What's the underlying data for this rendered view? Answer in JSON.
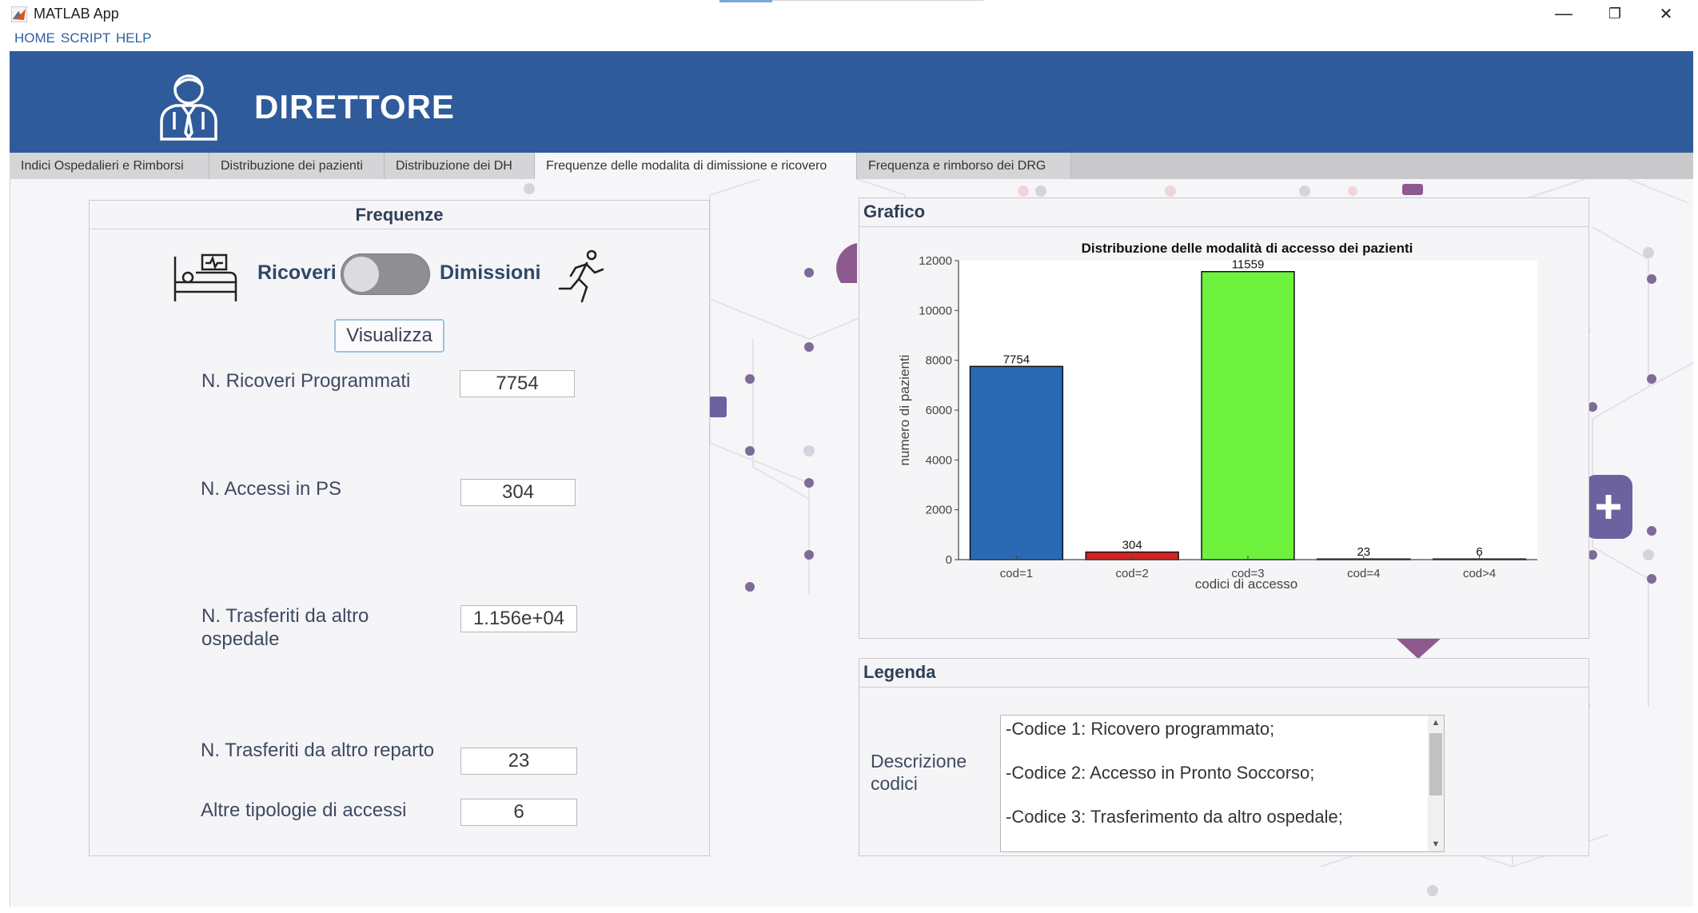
{
  "window": {
    "title": "MATLAB App",
    "minimize": "—",
    "maximize": "❐",
    "close": "✕"
  },
  "menu": {
    "items": [
      "HOME",
      "SCRIPT",
      "HELP"
    ]
  },
  "header": {
    "title": "DIRETTORE"
  },
  "tabs": [
    {
      "label": "Indici Ospedalieri e Rimborsi"
    },
    {
      "label": "Distribuzione dei pazienti"
    },
    {
      "label": "Distribuzione dei DH"
    },
    {
      "label": "Frequenze delle modalita di dimissione e ricovero"
    },
    {
      "label": "Frequenza e rimborso dei DRG"
    }
  ],
  "frequenze": {
    "title": "Frequenze",
    "switch_left": "Ricoveri",
    "switch_right": "Dimissioni",
    "switch_state": "Ricoveri",
    "button": "Visualizza",
    "fields": [
      {
        "label": "N. Ricoveri Programmati",
        "value": "7754"
      },
      {
        "label": "N. Accessi in PS",
        "value": "304"
      },
      {
        "label": "N. Trasferiti da altro\nospedale",
        "value": "1.156e+04"
      },
      {
        "label": "N. Trasferiti da altro reparto",
        "value": "23"
      },
      {
        "label": "Altre tipologie di accessi",
        "value": "6"
      }
    ]
  },
  "grafico": {
    "title": "Grafico"
  },
  "legenda": {
    "title": "Legenda",
    "label": "Descrizione\ncodici",
    "lines": [
      "-Codice 1: Ricovero programmato;",
      "-Codice 2: Accesso in Pronto Soccorso;",
      "-Codice 3: Trasferimento da altro ospedale;"
    ]
  },
  "chart_data": {
    "type": "bar",
    "title": "Distribuzione delle modalità di accesso dei pazienti",
    "xlabel": "codici di accesso",
    "ylabel": "numero di pazienti",
    "categories": [
      "cod=1",
      "cod=2",
      "cod=3",
      "cod=4",
      "cod>4"
    ],
    "values": [
      7754,
      304,
      11559,
      23,
      6
    ],
    "data_labels": [
      "7754",
      "304",
      "11559",
      "23",
      "6"
    ],
    "colors": [
      "#2a6ab5",
      "#d42323",
      "#6ef23e",
      "#2a6ab5",
      "#2a6ab5"
    ],
    "ylim": [
      0,
      12000
    ],
    "yticks": [
      0,
      2000,
      4000,
      6000,
      8000,
      10000,
      12000
    ],
    "grid": false
  }
}
